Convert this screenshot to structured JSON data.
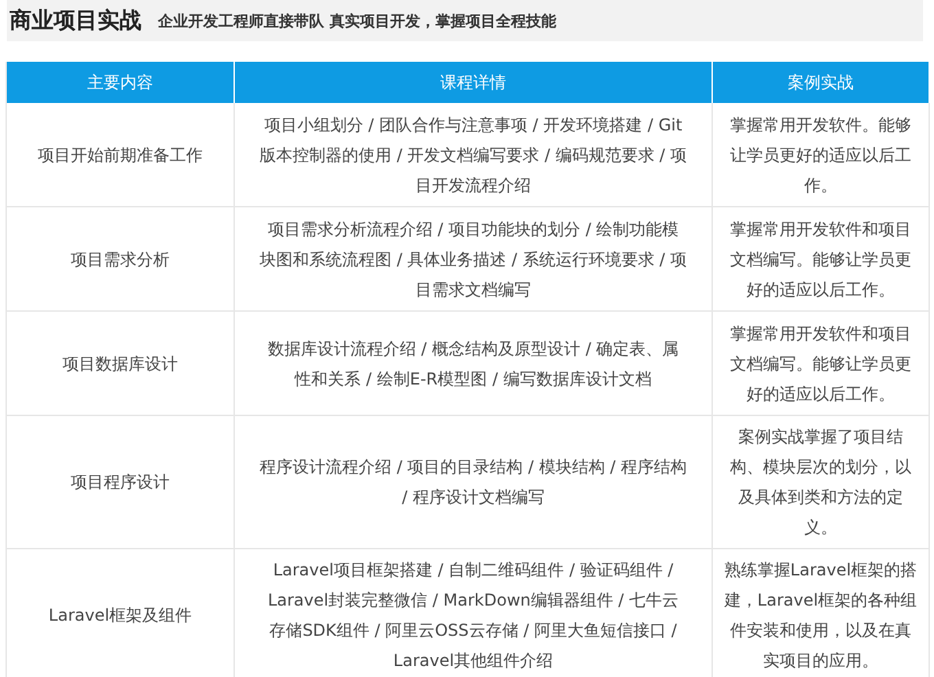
{
  "header": {
    "title": "商业项目实战",
    "subtitle": "企业开发工程师直接带队 真实项目开发，掌握项目全程技能"
  },
  "table": {
    "columns": [
      "主要内容",
      "课程详情",
      "案例实战"
    ],
    "rows": [
      [
        "项目开始前期准备工作",
        "项目小组划分 / 团队合作与注意事项 / 开发环境搭建 / Git版本控制器的使用 / 开发文档编写要求 / 编码规范要求 / 项目开发流程介绍",
        "掌握常用开发软件。能够让学员更好的适应以后工作。"
      ],
      [
        "项目需求分析",
        "项目需求分析流程介绍 / 项目功能块的划分 / 绘制功能模块图和系统流程图 / 具体业务描述 / 系统运行环境要求 / 项目需求文档编写",
        "掌握常用开发软件和项目文档编写。能够让学员更好的适应以后工作。"
      ],
      [
        "项目数据库设计",
        "数据库设计流程介绍 / 概念结构及原型设计 / 确定表、属性和关系 / 绘制E-R模型图 / 编写数据库设计文档",
        "掌握常用开发软件和项目文档编写。能够让学员更好的适应以后工作。"
      ],
      [
        "项目程序设计",
        "程序设计流程介绍 / 项目的目录结构 / 模块结构 / 程序结构 / 程序设计文档编写",
        "案例实战掌握了项目结构、模块层次的划分，以及具体到类和方法的定义。"
      ],
      [
        "Laravel框架及组件",
        "Laravel项目框架搭建 / 自制二维码组件 / 验证码组件 / Laravel封装完整微信 / MarkDown编辑器组件 / 七牛云存储SDK组件 / 阿里云OSS云存储 / 阿里大鱼短信接口 / Laravel其他组件介绍",
        "熟练掌握Laravel框架的搭建，Laravel框架的各种组件安装和使用，以及在真实项目的应用。"
      ]
    ]
  }
}
